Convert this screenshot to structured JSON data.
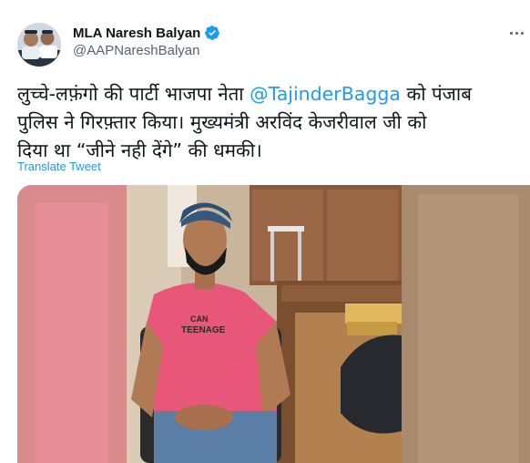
{
  "author": {
    "display_name": "MLA Naresh Balyan",
    "handle": "@AAPNareshBalyan",
    "verified": true
  },
  "tweet": {
    "text_line1_prefix": "लुच्चे-लफ़ंगो की पार्टी भाजपा नेता ",
    "mention": "@TajinderBagga",
    "text_line1_suffix": " को पंजाब",
    "text_line2": "पुलिस ने गिरफ़्तार किया। मुख्यमंत्री अरविंद केजरीवाल जी को",
    "text_line3": "दिया था “जीने नही देंगे” की धमकी।"
  },
  "translate_label": "Translate Tweet",
  "media": {
    "shirt_text_line1": "CAN",
    "shirt_text_line2": "TEENAGE"
  },
  "colors": {
    "link": "#1d9bf0",
    "secondary_text": "#536471",
    "verified_badge": "#1d9bf0"
  },
  "icons": {
    "verified": "verified-badge-icon",
    "more": "more-options-icon"
  }
}
